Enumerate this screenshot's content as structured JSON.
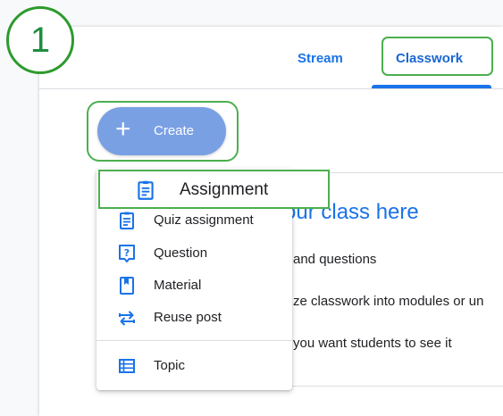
{
  "step_badge": "1",
  "tabs": [
    {
      "label": "Stream"
    },
    {
      "label": "Classwork"
    }
  ],
  "create_button": {
    "icon": "plus-icon",
    "label": "Create"
  },
  "create_menu": {
    "highlighted_item": {
      "label": "Assignment",
      "icon": "assignment-icon"
    },
    "items": [
      {
        "label": "Quiz assignment",
        "icon": "quiz-assignment-icon"
      },
      {
        "label": "Question",
        "icon": "question-icon"
      },
      {
        "label": "Material",
        "icon": "material-icon"
      },
      {
        "label": "Reuse post",
        "icon": "reuse-post-icon"
      },
      {
        "label": "Topic",
        "icon": "topic-icon"
      }
    ]
  },
  "content": {
    "heading": "our class here",
    "lines": [
      "and questions",
      "ze classwork into modules or un",
      "you want students to see it"
    ]
  },
  "colors": {
    "accent": "#1a73e8",
    "highlight": "#4caf50",
    "create_button": "#7aa0e4"
  }
}
